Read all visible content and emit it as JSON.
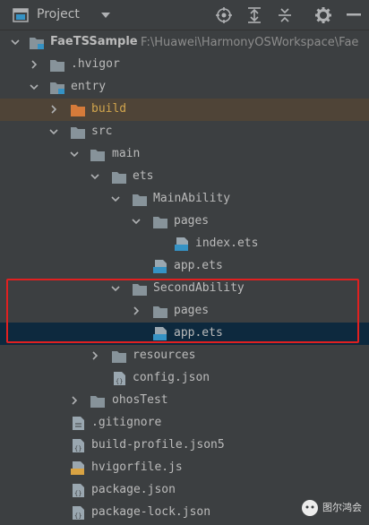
{
  "panel": {
    "title": "Project",
    "toolbar_icons": [
      "locate-icon",
      "expand-all-icon",
      "collapse-all-icon",
      "settings-icon",
      "hide-icon"
    ]
  },
  "tree": {
    "root_name": "FaeTSSample",
    "root_path": "F:\\Huawei\\HarmonyOSWorkspace\\Fae",
    "items": [
      {
        "label": ".hvigor"
      },
      {
        "label": "entry"
      },
      {
        "label": "build"
      },
      {
        "label": "src"
      },
      {
        "label": "main"
      },
      {
        "label": "ets"
      },
      {
        "label": "MainAbility"
      },
      {
        "label": "pages"
      },
      {
        "label": "index.ets"
      },
      {
        "label": "app.ets"
      },
      {
        "label": "SecondAbility"
      },
      {
        "label": "pages"
      },
      {
        "label": "app.ets"
      },
      {
        "label": "resources"
      },
      {
        "label": "config.json"
      },
      {
        "label": "ohosTest"
      },
      {
        "label": ".gitignore"
      },
      {
        "label": "build-profile.json5"
      },
      {
        "label": "hvigorfile.js"
      },
      {
        "label": "package.json"
      },
      {
        "label": "package-lock.json"
      }
    ]
  },
  "watermark": {
    "text": "图尔鸿会"
  },
  "colors": {
    "background": "#3c3f41",
    "selection": "#0d293e",
    "excluded_folder": "#4f4437",
    "highlight_box": "#e02020"
  }
}
